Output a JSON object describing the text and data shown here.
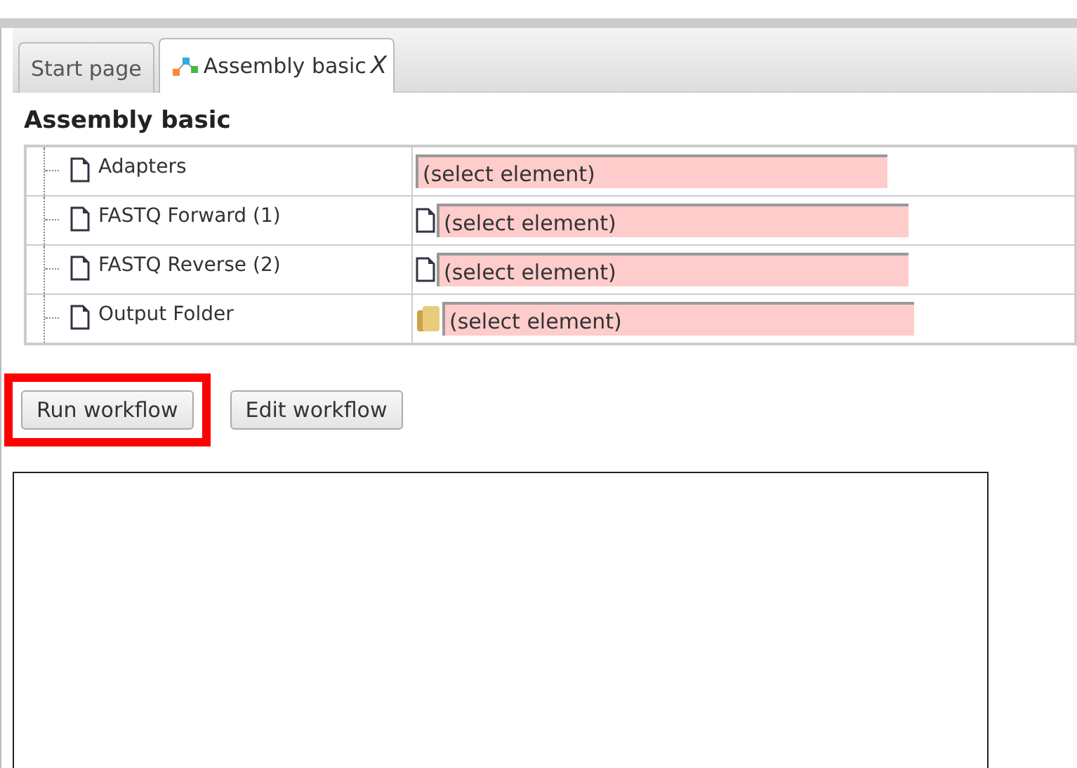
{
  "tabs": [
    {
      "kind": "plain",
      "label": "Start page",
      "selected": false
    },
    {
      "kind": "workflow",
      "label": "Assembly basic",
      "selected": true,
      "close_label": "X"
    }
  ],
  "heading": "Assembly basic",
  "parameters": [
    {
      "name": "Adapters",
      "kind": "text",
      "value": "(select element)"
    },
    {
      "name": "FASTQ Forward (1)",
      "kind": "file",
      "value": "(select element)"
    },
    {
      "name": "FASTQ Reverse (2)",
      "kind": "file",
      "value": "(select element)"
    },
    {
      "name": "Output Folder",
      "kind": "folder",
      "value": "(select element)"
    }
  ],
  "buttons": [
    {
      "label": "Run workflow",
      "highlighted": true
    },
    {
      "label": "Edit workflow",
      "highlighted": false
    }
  ]
}
